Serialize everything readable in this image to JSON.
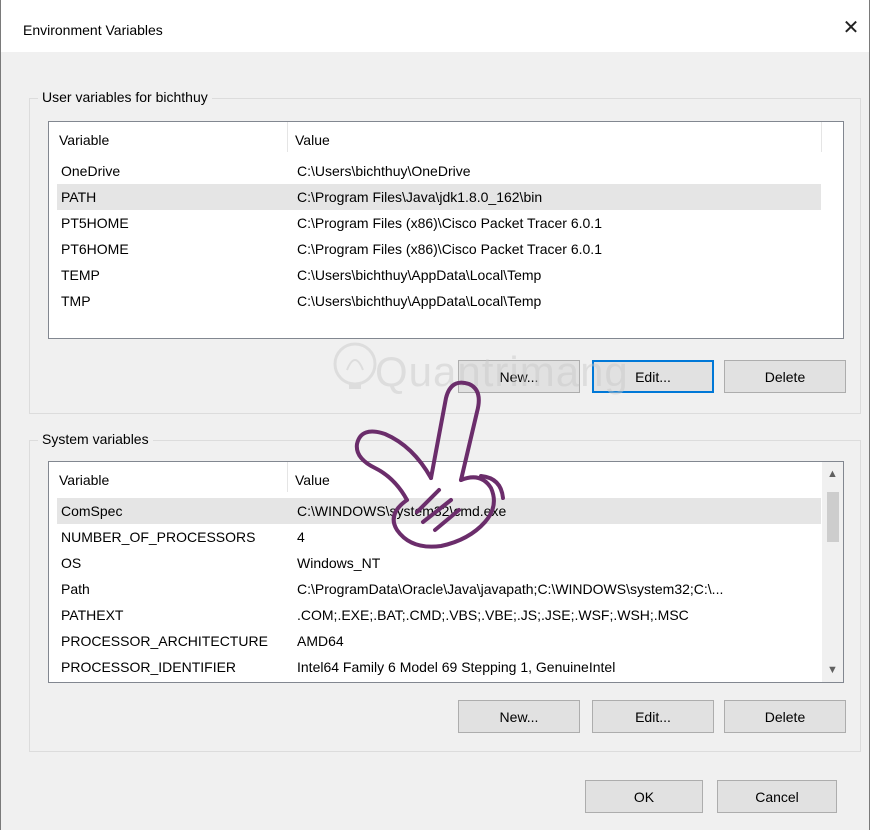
{
  "window": {
    "title": "Environment Variables",
    "close_glyph": "✕"
  },
  "user_group": {
    "label": "User variables for bichthuy",
    "columns": {
      "variable": "Variable",
      "value": "Value"
    },
    "rows": [
      {
        "variable": "OneDrive",
        "value": "C:\\Users\\bichthuy\\OneDrive"
      },
      {
        "variable": "PATH",
        "value": "C:\\Program Files\\Java\\jdk1.8.0_162\\bin"
      },
      {
        "variable": "PT5HOME",
        "value": "C:\\Program Files (x86)\\Cisco Packet Tracer 6.0.1"
      },
      {
        "variable": "PT6HOME",
        "value": "C:\\Program Files (x86)\\Cisco Packet Tracer 6.0.1"
      },
      {
        "variable": "TEMP",
        "value": "C:\\Users\\bichthuy\\AppData\\Local\\Temp"
      },
      {
        "variable": "TMP",
        "value": "C:\\Users\\bichthuy\\AppData\\Local\\Temp"
      }
    ],
    "buttons": {
      "new": "New...",
      "edit": "Edit...",
      "delete": "Delete"
    }
  },
  "system_group": {
    "label": "System variables",
    "columns": {
      "variable": "Variable",
      "value": "Value"
    },
    "rows": [
      {
        "variable": "ComSpec",
        "value": "C:\\WINDOWS\\system32\\cmd.exe"
      },
      {
        "variable": "NUMBER_OF_PROCESSORS",
        "value": "4"
      },
      {
        "variable": "OS",
        "value": "Windows_NT"
      },
      {
        "variable": "Path",
        "value": "C:\\ProgramData\\Oracle\\Java\\javapath;C:\\WINDOWS\\system32;C:\\..."
      },
      {
        "variable": "PATHEXT",
        "value": ".COM;.EXE;.BAT;.CMD;.VBS;.VBE;.JS;.JSE;.WSF;.WSH;.MSC"
      },
      {
        "variable": "PROCESSOR_ARCHITECTURE",
        "value": "AMD64"
      },
      {
        "variable": "PROCESSOR_IDENTIFIER",
        "value": "Intel64 Family 6 Model 69 Stepping 1, GenuineIntel"
      }
    ],
    "buttons": {
      "new": "New...",
      "edit": "Edit...",
      "delete": "Delete"
    }
  },
  "dialog_buttons": {
    "ok": "OK",
    "cancel": "Cancel"
  },
  "watermark": {
    "text": "Quantrimang"
  },
  "colors": {
    "focus_border": "#0078d7",
    "selected_row": "#e5e5e5",
    "hand_stroke": "#6b2d6b"
  }
}
